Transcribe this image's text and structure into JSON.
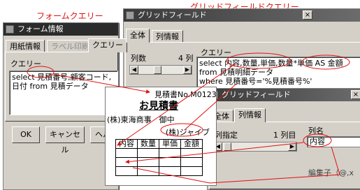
{
  "captions": {
    "form_query": "フォームクエリー",
    "grid_field_query": "グリッドフィールドクエリー"
  },
  "form_window": {
    "title": "フォーム情報",
    "tabs": [
      "用紙情報",
      "ラベル印刷",
      "クエリー"
    ],
    "query_label": "クエリー",
    "query_text": "select 見積番号,顧客コード,\n日付 from 見積データ",
    "buttons": {
      "ok": "OK",
      "cancel": "キャンセル",
      "help": "ヘル"
    }
  },
  "grid_window_1": {
    "title": "グリッドフィールド",
    "close_glyph": "×",
    "tabs": [
      "全体",
      "列情報"
    ],
    "column_count_label": "列数",
    "column_count_value": "4 列",
    "query_label": "クエリー",
    "query_text": "select 内容,数量,単価,数量*単価 AS 金額\nfrom 見積明細データ\nwhere 見積番号='%見積番号%'"
  },
  "grid_window_2": {
    "title": "グリッドフィールド",
    "close_glyph": "×",
    "tabs": [
      "全体",
      "列情報"
    ],
    "column_spec_label": "列指定",
    "column_spec_value": "1 列目",
    "column_name_label": "列名",
    "column_name_value": "内容",
    "cut_label": "編集子（@,x"
  },
  "estimate_doc": {
    "number": "見積書No.M0123",
    "title": "お見積書",
    "customer": "(株)東海商事　御中",
    "issuer": "(株)ジャイブ",
    "headers": [
      "内容",
      "数量",
      "単価",
      "金額"
    ]
  },
  "colors": {
    "accent_red": "#e01010",
    "window_gray": "#d4d0c8"
  }
}
